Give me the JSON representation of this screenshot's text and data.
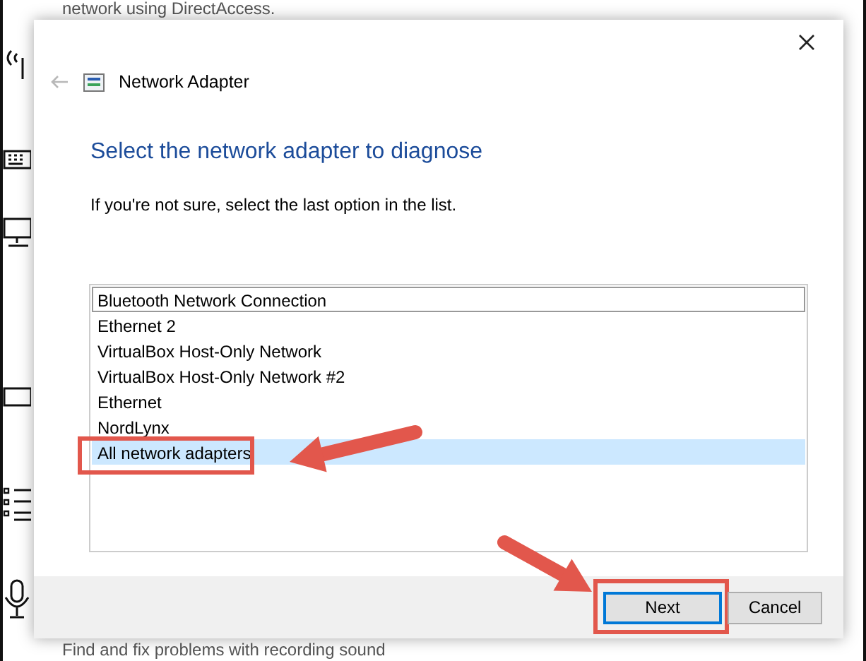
{
  "background": {
    "top_text": "network using DirectAccess.",
    "bottom_text": "Find and fix problems with recording sound"
  },
  "dialog": {
    "title": "Network Adapter",
    "back": {
      "disabled": true
    },
    "heading": "Select the network adapter to diagnose",
    "instruction": "If you're not sure, select the last option in the list.",
    "adapters": [
      {
        "label": "Bluetooth Network Connection",
        "selected": false,
        "focused": true,
        "highlighted": false
      },
      {
        "label": "Ethernet 2",
        "selected": false,
        "focused": false,
        "highlighted": false
      },
      {
        "label": "VirtualBox Host-Only Network",
        "selected": false,
        "focused": false,
        "highlighted": false
      },
      {
        "label": "VirtualBox Host-Only Network #2",
        "selected": false,
        "focused": false,
        "highlighted": false
      },
      {
        "label": "Ethernet",
        "selected": false,
        "focused": false,
        "highlighted": false
      },
      {
        "label": "NordLynx",
        "selected": false,
        "focused": false,
        "highlighted": false
      },
      {
        "label": "All network adapters",
        "selected": true,
        "focused": false,
        "highlighted": true
      }
    ],
    "buttons": [
      {
        "label": "Next",
        "default": true,
        "highlighted": true
      },
      {
        "label": "Cancel",
        "default": false,
        "highlighted": false
      }
    ]
  }
}
